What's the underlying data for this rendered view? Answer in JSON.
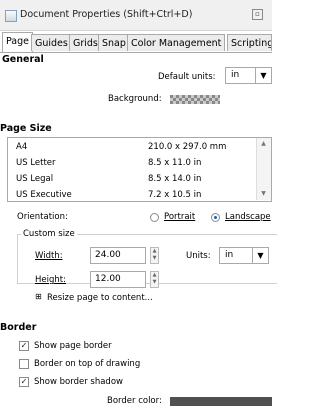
{
  "window": {
    "title": "Document Properties (Shift+Ctrl+D)"
  },
  "tabs": [
    "Page",
    "Guides",
    "Grids",
    "Snap",
    "Color Management",
    "Scripting"
  ],
  "general": {
    "heading": "General",
    "default_units_label": "Default units:",
    "default_units_value": "in",
    "background_label": "Background:"
  },
  "page_size": {
    "heading": "Page Size",
    "sizes": [
      {
        "name": "A4",
        "dims": "210.0 x 297.0 mm"
      },
      {
        "name": "US Letter",
        "dims": "8.5 x 11.0 in"
      },
      {
        "name": "US Legal",
        "dims": "8.5 x 14.0 in"
      },
      {
        "name": "US Executive",
        "dims": "7.2 x 10.5 in"
      }
    ],
    "orientation_label": "Orientation:",
    "portrait_label": "Portrait",
    "landscape_label": "Landscape",
    "selected_orientation": "landscape",
    "custom_size": {
      "legend": "Custom size",
      "width_label": "Width:",
      "width_value": "24.00",
      "height_label": "Height:",
      "height_value": "12.00",
      "units_label": "Units:",
      "units_value": "in"
    },
    "resize_label": "Resize page to content..."
  },
  "border": {
    "heading": "Border",
    "show_page_border": {
      "label": "Show page border",
      "checked": true
    },
    "border_on_top": {
      "label": "Border on top of drawing",
      "checked": false
    },
    "show_border_shadow": {
      "label": "Show border shadow",
      "checked": true
    },
    "border_color_label": "Border color:",
    "border_color": "#505050"
  }
}
